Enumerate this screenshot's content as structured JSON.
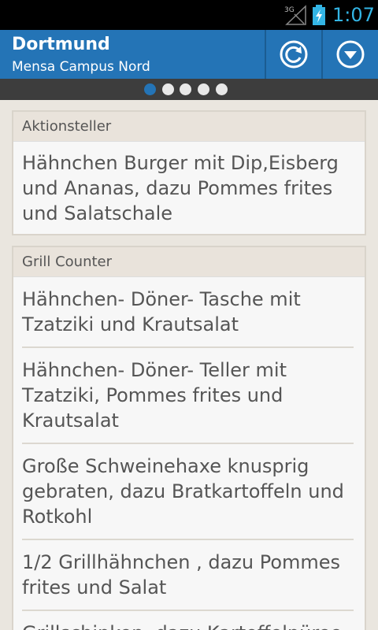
{
  "status_bar": {
    "network_label": "3G",
    "time": "1:07"
  },
  "action_bar": {
    "title": "Dortmund",
    "subtitle": "Mensa Campus Nord",
    "refresh_icon": "refresh-icon",
    "menu_icon": "dropdown-circle-icon"
  },
  "pager": {
    "count": 5,
    "active_index": 0
  },
  "colors": {
    "accent": "#2474b6",
    "status_time": "#33b5e5"
  },
  "sections": [
    {
      "title": "Aktionsteller",
      "items": [
        "Hähnchen Burger mit Dip,Eisberg und Ananas, dazu Pommes frites und Salatschale"
      ]
    },
    {
      "title": "Grill Counter",
      "items": [
        "Hähnchen- Döner- Tasche mit Tzatziki und Krautsalat",
        "Hähnchen- Döner- Teller mit Tzatziki, Pommes frites und Krautsalat",
        "Große Schweinehaxe knusprig gebraten, dazu Bratkartoffeln und Rotkohl",
        "1/2 Grillhähnchen , dazu Pommes frites und Salat",
        "Grillschinken, dazu Kartoffelpüree"
      ]
    }
  ]
}
